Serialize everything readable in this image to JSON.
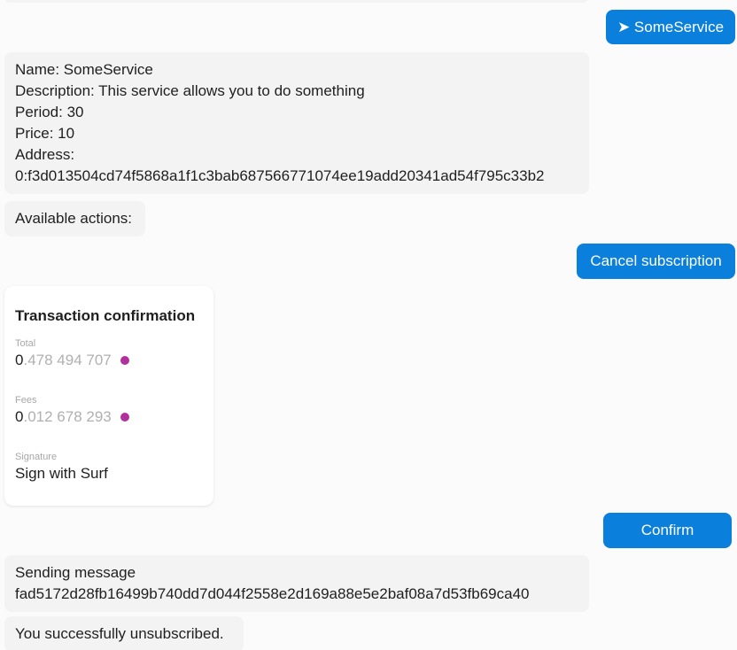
{
  "messages": {
    "service_button": "➤ SomeService",
    "service_info": {
      "name_line": "Name: SomeService",
      "description_line": "Description: This service allows you to do something",
      "period_line": "Period: 30",
      "price_line": "Price: 10",
      "address_label": "Address:",
      "address_value": "0:f3d013504cd74f5868a1f1c3bab687566771074ee19add20341ad54f795c33b2"
    },
    "available_actions": "Available actions:",
    "cancel_button": "Cancel subscription",
    "transaction": {
      "title": "Transaction confirmation",
      "total_label": "Total",
      "total_int": "0",
      "total_frac": ".478 494 707",
      "fees_label": "Fees",
      "fees_int": "0",
      "fees_frac": ".012 678 293",
      "signature_label": "Signature",
      "signature_value": "Sign with Surf",
      "coin_color": "#b0309c"
    },
    "confirm_button": "Confirm",
    "sending": {
      "line1": "Sending message",
      "line2": "fad5172d28fb16499b740dd7d044f2558e2d169a88e5e2baf08a7d53fb69ca40"
    },
    "result": "You successfully unsubscribed."
  },
  "colors": {
    "accent": "#0a7fdc",
    "incoming_bg": "#f3f3f3",
    "page_bg": "#fbfbfb"
  }
}
